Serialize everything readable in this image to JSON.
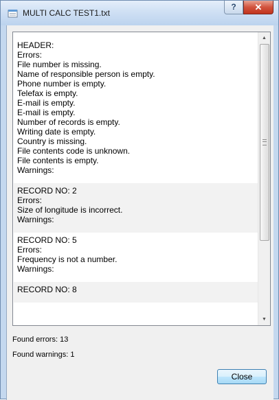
{
  "window": {
    "title": "MULTI CALC TEST1.txt",
    "help_label": "?",
    "close_glyph": "✕",
    "icon": "notepad-icon"
  },
  "report": {
    "blocks": [
      {
        "lines": [
          "HEADER:",
          "Errors:",
          "File number is missing.",
          "Name of responsible person is empty.",
          "Phone number is empty.",
          "Telefax is empty.",
          "E-mail is empty.",
          "E-mail is empty.",
          "Number of records is empty.",
          "Writing date is empty.",
          "Country is missing.",
          "File contents code is unknown.",
          "File contents is empty.",
          "Warnings:"
        ]
      },
      {
        "lines": [
          "RECORD NO: 2",
          "Errors:",
          "Size of longitude is incorrect.",
          "Warnings:"
        ]
      },
      {
        "lines": [
          "RECORD NO: 5",
          "Errors:",
          "Frequency is not a number.",
          "Warnings:"
        ]
      },
      {
        "lines": [
          "RECORD NO: 8"
        ]
      }
    ]
  },
  "scrollbar": {
    "up_icon": "scroll-up-arrow-icon",
    "down_icon": "scroll-down-arrow-icon",
    "thumb_position_fraction": 0.0
  },
  "summary": {
    "found_errors": "Found errors: 13",
    "found_warnings": "Found warnings: 1"
  },
  "buttons": {
    "close_label": "Close"
  },
  "colors": {
    "title_gradient": "#cfe0f4",
    "close_button_red": "#c1331c",
    "alt_row": "#f2f2f2"
  }
}
